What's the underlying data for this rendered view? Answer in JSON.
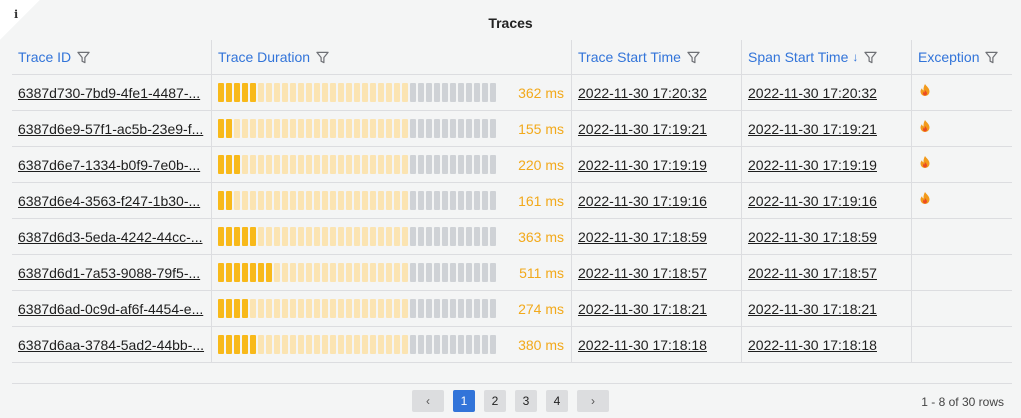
{
  "panel": {
    "info_icon": "i",
    "title": "Traces"
  },
  "columns": {
    "trace_id": "Trace ID",
    "trace_duration": "Trace Duration",
    "trace_start_time": "Trace Start Time",
    "span_start_time": "Span Start Time",
    "span_sort": "↓",
    "exception": "Exception"
  },
  "icons": {
    "filter": "filter-icon",
    "sort": "arrow-down-icon",
    "exception": "fire-icon",
    "prev": "chevron-left-icon",
    "next": "chevron-right-icon"
  },
  "colors": {
    "accent": "#3274d9",
    "gauge_on": "#f8b91a",
    "gauge_dim": "#fbe4b2",
    "gauge_off": "#cfd2d6",
    "duration_text": "#f2a91b"
  },
  "rows": [
    {
      "trace_id": "6387d730-7bd9-4fe1-4487-...",
      "duration": "362 ms",
      "duration_level": 0.071,
      "start": "2022-11-30 17:20:32",
      "span_start": "2022-11-30 17:20:32",
      "exception": true
    },
    {
      "trace_id": "6387d6e9-57f1-ac5b-23e9-f...",
      "duration": "155 ms",
      "duration_level": 0.03,
      "start": "2022-11-30 17:19:21",
      "span_start": "2022-11-30 17:19:21",
      "exception": true
    },
    {
      "trace_id": "6387d6e7-1334-b0f9-7e0b-...",
      "duration": "220 ms",
      "duration_level": 0.043,
      "start": "2022-11-30 17:19:19",
      "span_start": "2022-11-30 17:19:19",
      "exception": true
    },
    {
      "trace_id": "6387d6e4-3563-f247-1b30-...",
      "duration": "161 ms",
      "duration_level": 0.032,
      "start": "2022-11-30 17:19:16",
      "span_start": "2022-11-30 17:19:16",
      "exception": true
    },
    {
      "trace_id": "6387d6d3-5eda-4242-44cc-...",
      "duration": "363 ms",
      "duration_level": 0.071,
      "start": "2022-11-30 17:18:59",
      "span_start": "2022-11-30 17:18:59",
      "exception": false
    },
    {
      "trace_id": "6387d6d1-7a53-9088-79f5-...",
      "duration": "511 ms",
      "duration_level": 0.1,
      "start": "2022-11-30 17:18:57",
      "span_start": "2022-11-30 17:18:57",
      "exception": false
    },
    {
      "trace_id": "6387d6ad-0c9d-af6f-4454-e...",
      "duration": "274 ms",
      "duration_level": 0.054,
      "start": "2022-11-30 17:18:21",
      "span_start": "2022-11-30 17:18:21",
      "exception": false
    },
    {
      "trace_id": "6387d6aa-3784-5ad2-44bb-...",
      "duration": "380 ms",
      "duration_level": 0.074,
      "start": "2022-11-30 17:18:18",
      "span_start": "2022-11-30 17:18:18",
      "exception": false
    }
  ],
  "pagination": {
    "prev": "‹",
    "pages": [
      "1",
      "2",
      "3",
      "4"
    ],
    "active_page": "1",
    "next": "›",
    "row_count": "1 - 8 of 30 rows"
  }
}
